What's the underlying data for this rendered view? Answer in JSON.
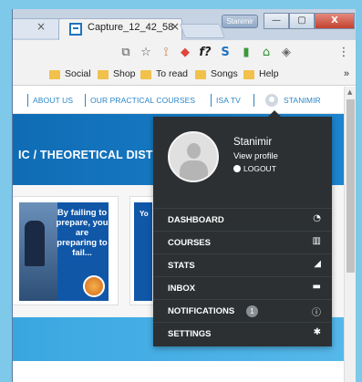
{
  "browser": {
    "tab_prev_close": "×",
    "tab_title": "Capture_12_42_58",
    "tab_close": "×",
    "user_pill": "Stanimir",
    "win_minimize": "—",
    "win_maximize": "▢",
    "win_close": "X",
    "bookmarks": [
      "Social",
      "Shop",
      "To read",
      "Songs",
      "Help"
    ],
    "bookmarks_more": "»",
    "toolbar_glyphs": {
      "translate": "⧉",
      "star": "☆",
      "tool": "⟟",
      "pinwheel": "◆",
      "fx": "f?",
      "s_ext": "S",
      "chart": "▮",
      "home": "⌂",
      "cube": "◈",
      "menu": "⋮"
    }
  },
  "site": {
    "nav": [
      "ABOUT US",
      "OUR PRACTICAL COURSES",
      "ISA TV"
    ],
    "nav_user": "STANIMIR",
    "hero_text": "IC / THEORETICAL DIST",
    "promo_text": "By failing to prepare, you are preparing to fail...",
    "promo2_text": "Yo"
  },
  "dropdown": {
    "name": "Stanimir",
    "view_profile": "View profile",
    "logout": "LOGOUT",
    "menu": [
      {
        "label": "DASHBOARD",
        "icon": "◔",
        "icon_name": "dashboard-icon"
      },
      {
        "label": "COURSES",
        "icon": "▥",
        "icon_name": "book-icon"
      },
      {
        "label": "STATS",
        "icon": "◢",
        "icon_name": "stats-icon"
      },
      {
        "label": "INBOX",
        "icon": "▬",
        "icon_name": "inbox-icon"
      },
      {
        "label": "NOTIFICATIONS",
        "icon": "ⓘ",
        "icon_name": "notification-icon",
        "badge": "1"
      },
      {
        "label": "SETTINGS",
        "icon": "✱",
        "icon_name": "gear-icon"
      }
    ]
  },
  "colors": {
    "nav_blue": "#2a86c8",
    "hero_blue": "#0f6cb4",
    "dropdown_bg": "#2c3033",
    "backdrop": "#7ec8e9"
  }
}
